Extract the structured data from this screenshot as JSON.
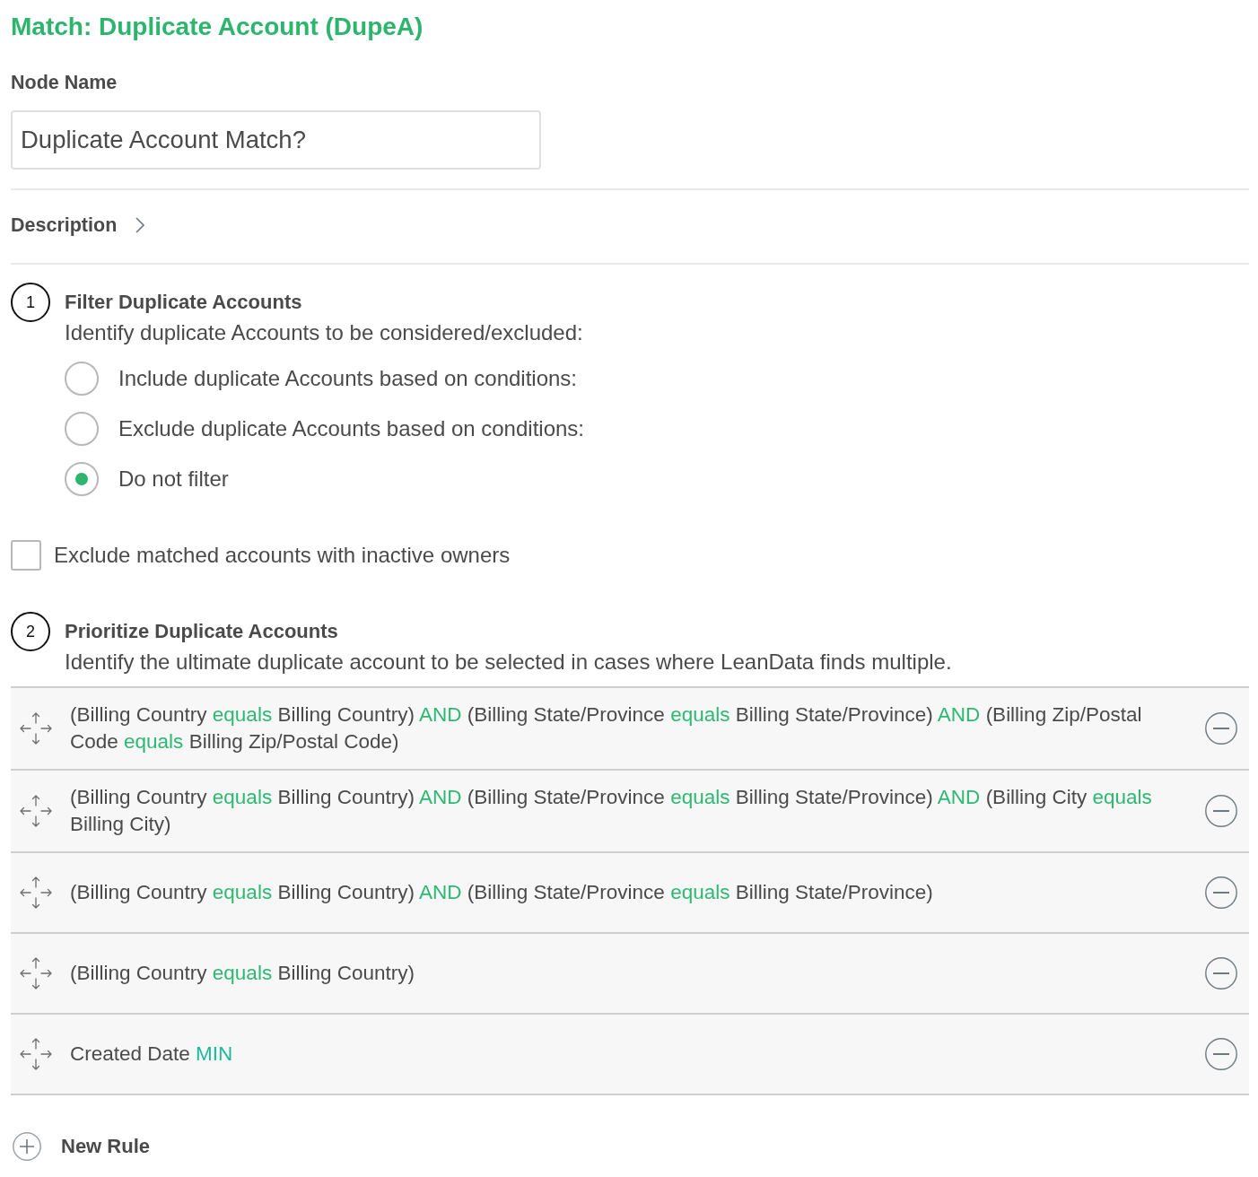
{
  "title": "Match: Duplicate Account (DupeA)",
  "node_name": {
    "label": "Node Name",
    "value": "Duplicate Account Match?"
  },
  "description": {
    "label": "Description",
    "expanded": false
  },
  "filter_step": {
    "number": "1",
    "title": "Filter Duplicate Accounts",
    "subtitle": "Identify duplicate Accounts to be considered/excluded:",
    "options": [
      {
        "label": "Include duplicate Accounts based on conditions:",
        "selected": false
      },
      {
        "label": "Exclude duplicate Accounts based on conditions:",
        "selected": false
      },
      {
        "label": "Do not filter",
        "selected": true
      }
    ]
  },
  "inactive_owners": {
    "label": "Exclude matched accounts with inactive owners",
    "checked": false
  },
  "prioritize_step": {
    "number": "2",
    "title": "Prioritize Duplicate Accounts",
    "subtitle": "Identify the ultimate duplicate account to be selected in cases where LeanData finds multiple.",
    "rules": [
      {
        "segments": [
          {
            "kind": "field",
            "text": "(Billing Country"
          },
          {
            "kind": "operator",
            "text": "equals"
          },
          {
            "kind": "field",
            "text": "Billing Country)"
          },
          {
            "kind": "operator",
            "text": "AND"
          },
          {
            "kind": "field",
            "text": "(Billing State/Province"
          },
          {
            "kind": "operator",
            "text": "equals"
          },
          {
            "kind": "field",
            "text": "Billing State/Province)"
          },
          {
            "kind": "operator",
            "text": "AND"
          },
          {
            "kind": "field",
            "text": "(Billing Zip/Postal Code"
          },
          {
            "kind": "operator",
            "text": "equals"
          },
          {
            "kind": "field",
            "text": "Billing Zip/Postal Code)"
          }
        ]
      },
      {
        "segments": [
          {
            "kind": "field",
            "text": "(Billing Country"
          },
          {
            "kind": "operator",
            "text": "equals"
          },
          {
            "kind": "field",
            "text": "Billing Country)"
          },
          {
            "kind": "operator",
            "text": "AND"
          },
          {
            "kind": "field",
            "text": "(Billing State/Province"
          },
          {
            "kind": "operator",
            "text": "equals"
          },
          {
            "kind": "field",
            "text": "Billing State/Province)"
          },
          {
            "kind": "operator",
            "text": "AND"
          },
          {
            "kind": "field",
            "text": "(Billing City"
          },
          {
            "kind": "operator",
            "text": "equals"
          },
          {
            "kind": "field",
            "text": "Billing City)"
          }
        ]
      },
      {
        "segments": [
          {
            "kind": "field",
            "text": "(Billing Country"
          },
          {
            "kind": "operator",
            "text": "equals"
          },
          {
            "kind": "field",
            "text": "Billing Country)"
          },
          {
            "kind": "operator",
            "text": "AND"
          },
          {
            "kind": "field",
            "text": "(Billing State/Province"
          },
          {
            "kind": "operator",
            "text": "equals"
          },
          {
            "kind": "field",
            "text": "Billing State/Province)"
          }
        ]
      },
      {
        "segments": [
          {
            "kind": "field",
            "text": "(Billing Country"
          },
          {
            "kind": "operator",
            "text": "equals"
          },
          {
            "kind": "field",
            "text": "Billing Country)"
          }
        ]
      },
      {
        "segments": [
          {
            "kind": "field",
            "text": "Created Date"
          },
          {
            "kind": "function",
            "text": "MIN"
          }
        ]
      }
    ]
  },
  "new_rule": {
    "label": "New Rule"
  }
}
